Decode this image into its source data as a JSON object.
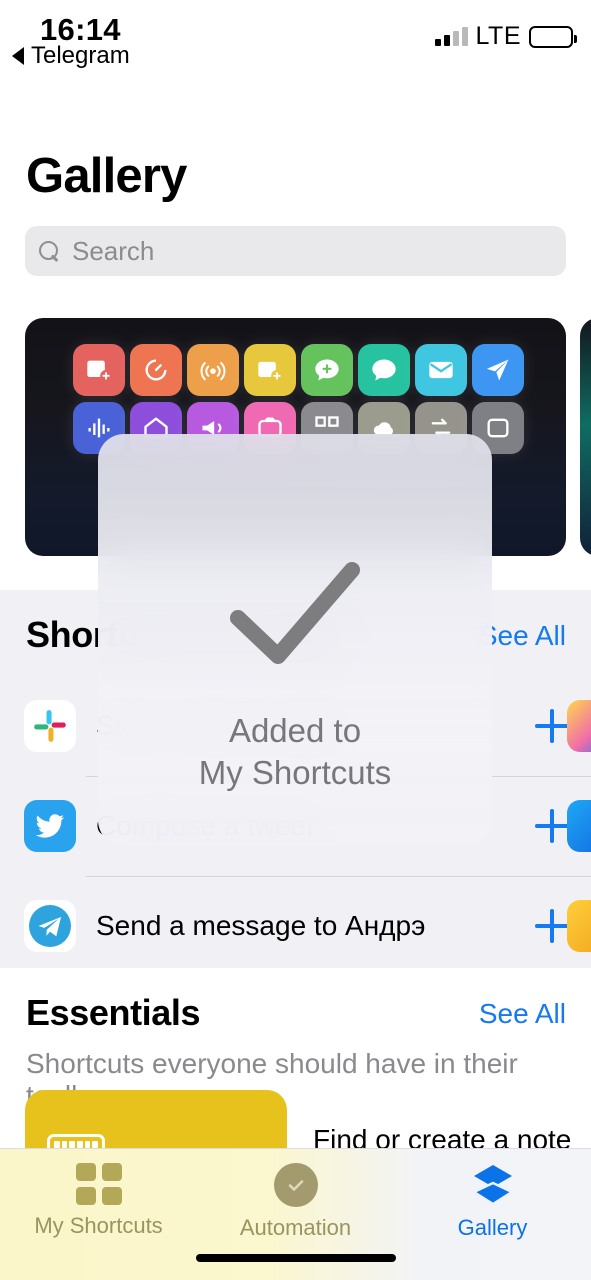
{
  "status_bar": {
    "time": "16:14",
    "back_app": "Telegram",
    "network": "LTE",
    "signal_bars_filled": 2,
    "signal_bars_total": 4,
    "battery_full": true
  },
  "header": {
    "title": "Gallery"
  },
  "search": {
    "placeholder": "Search",
    "value": "",
    "icon": "search-icon"
  },
  "banner": {
    "icons": [
      {
        "name": "calendar-add-icon",
        "color": "#e4635e"
      },
      {
        "name": "timer-icon",
        "color": "#ee7452"
      },
      {
        "name": "broadcast-icon",
        "color": "#eda049"
      },
      {
        "name": "note-add-icon",
        "color": "#e7c83c"
      },
      {
        "name": "message-add-icon",
        "color": "#65c35e"
      },
      {
        "name": "chat-bubble-icon",
        "color": "#27c2a0"
      },
      {
        "name": "mail-icon",
        "color": "#3fc6e0"
      },
      {
        "name": "paper-plane-icon",
        "color": "#3c96f2"
      },
      {
        "name": "waveform-icon",
        "color": "#4a62d8"
      },
      {
        "name": "home-icon",
        "color": "#8d4fdb"
      },
      {
        "name": "megaphone-icon",
        "color": "#b85ae0"
      },
      {
        "name": "photos-icon",
        "color": "#ef6ab2"
      },
      {
        "name": "qr-icon",
        "color": "#8a8a8f"
      },
      {
        "name": "cloud-icon",
        "color": "#9c9c8e"
      },
      {
        "name": "repeat-icon",
        "color": "#96938c"
      },
      {
        "name": "misc-icon",
        "color": "#7f7f86"
      }
    ]
  },
  "shortcuts_section": {
    "title": "Shortcuts for Apps",
    "see_all": "See All",
    "rows": [
      {
        "app": "slack-icon",
        "label": "Start a Slack huddle",
        "add": "+"
      },
      {
        "app": "twitter-icon",
        "label": "Compose a tweet",
        "add": "+"
      },
      {
        "app": "telegram-icon",
        "label": "Send a message to Андрэ",
        "add": "+"
      }
    ]
  },
  "essentials_section": {
    "title": "Essentials",
    "see_all": "See All",
    "subtitle": "Shortcuts everyone should have in their toolb…",
    "cards": [
      {
        "label": "Find or create a note",
        "color": "#e8c21c",
        "icon": "keyboard-icon"
      },
      {
        "label": "",
        "color": "#19a3f5",
        "icon": "card-icon"
      }
    ]
  },
  "hud": {
    "icon": "checkmark-icon",
    "line1": "Added to",
    "line2": "My Shortcuts"
  },
  "tab_bar": {
    "tabs": [
      {
        "label": "My Shortcuts",
        "icon": "grid-icon",
        "active": false
      },
      {
        "label": "Automation",
        "icon": "automation-clock-icon",
        "active": false
      },
      {
        "label": "Gallery",
        "icon": "layers-icon",
        "active": true
      }
    ],
    "active_color": "#0b72e8",
    "inactive_color": "#9a9461"
  }
}
